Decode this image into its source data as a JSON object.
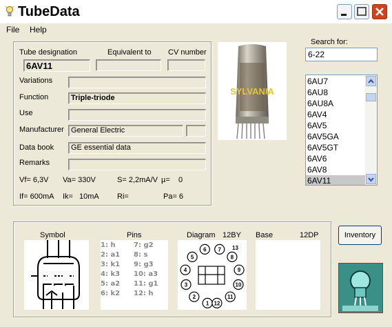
{
  "window": {
    "title": "TubeData"
  },
  "menu": [
    {
      "label": "File"
    },
    {
      "label": "Help"
    }
  ],
  "header_labels": {
    "designation": "Tube designation",
    "equivalent": "Equivalent to",
    "cv": "CV number"
  },
  "tube": {
    "designation": "6AV11",
    "equivalent": "",
    "cv": "",
    "variations": "",
    "function": "Triple-triode",
    "use": "",
    "manufacturer": "General Electric",
    "manufacturer_code": "",
    "databook": "GE essential data",
    "remarks": ""
  },
  "labels": {
    "variations": "Variations",
    "function": "Function",
    "use": "Use",
    "manufacturer": "Manufacturer",
    "databook": "Data book",
    "remarks": "Remarks"
  },
  "specs": {
    "vf": "Vf= 6,3V",
    "va": "Va= 330V",
    "s": "S= 2,2mA/V",
    "mu": "µ=",
    "mu_val": "0",
    "if": "If= 600mA",
    "ik": "Ik=",
    "ik_val": "10mA",
    "ri": "Ri=",
    "pa": "Pa= 6"
  },
  "photo": {
    "brand_text": "SYLVANIA"
  },
  "search": {
    "label": "Search for:",
    "value": "6-22"
  },
  "tube_list": [
    "6AU7",
    "6AU8",
    "6AU8A",
    "6AV4",
    "6AV5",
    "6AV5GA",
    "6AV5GT",
    "6AV6",
    "6AV8",
    "6AV11"
  ],
  "selected_index": 9,
  "bottom": {
    "symbol_label": "Symbol",
    "pins_label": "Pins",
    "diagram_label": "Diagram",
    "diagram_code": "12BY",
    "base_label": "Base",
    "base_code": "12DP"
  },
  "pins": [
    {
      "left": "1: h",
      "right": "7: g2"
    },
    {
      "left": "2: a1",
      "right": "8: s"
    },
    {
      "left": "3: k1",
      "right": "9: g3"
    },
    {
      "left": "4: k3",
      "right": "10: a3"
    },
    {
      "left": "5: a2",
      "right": "11: g1"
    },
    {
      "left": "6: k2",
      "right": "12: h"
    }
  ],
  "diagram_pins": [
    "1",
    "2",
    "3",
    "4",
    "5",
    "6",
    "7",
    "8",
    "9",
    "10",
    "11",
    "12"
  ],
  "diagram_extra": "13",
  "buttons": {
    "inventory": "Inventory"
  },
  "colors": {
    "bg": "#ece9d8",
    "titlebar": "#ffffff",
    "close": "#d0431f",
    "selection": "#c8c8c8",
    "logo_bg": "#3a8f86"
  }
}
